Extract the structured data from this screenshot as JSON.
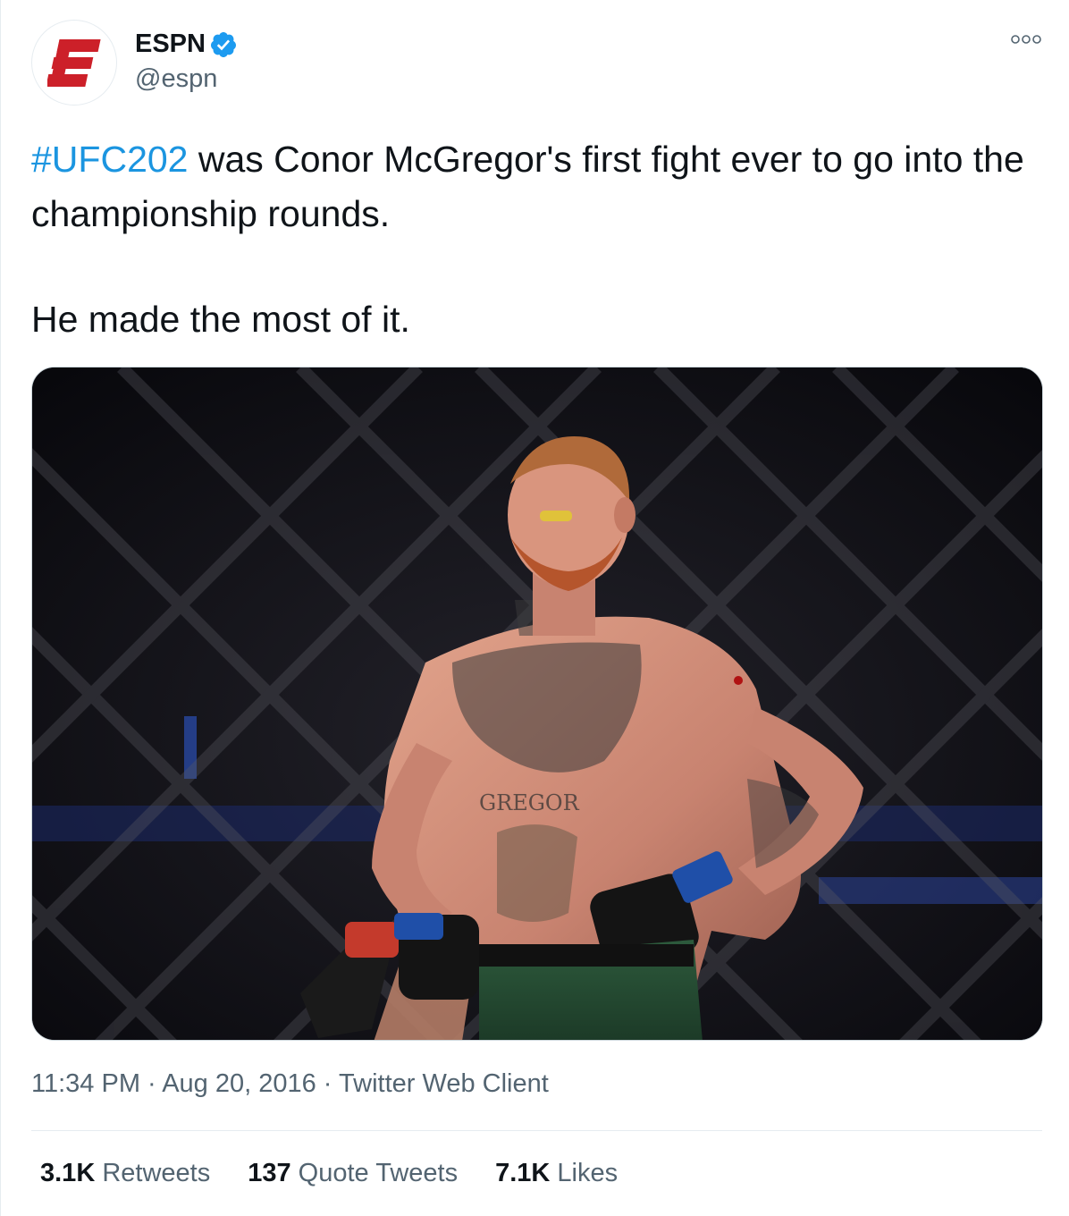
{
  "author": {
    "display_name": "ESPN",
    "handle": "@espn",
    "verified": true,
    "avatar_logo": "espn-e-logo",
    "brand_color": "#cc2029"
  },
  "tweet": {
    "hashtag": "#UFC202",
    "text_line1_rest": " was Conor McGregor's first fight ever to go into the championship rounds.",
    "text_para2": "He made the most of it.",
    "media_alt": "Conor McGregor in the octagon at UFC 202",
    "time": "11:34 PM",
    "separator": "·",
    "date": "Aug 20, 2016",
    "source": "Twitter Web Client"
  },
  "stats": {
    "retweets_count": "3.1K",
    "retweets_label": "Retweets",
    "quotes_count": "137",
    "quotes_label": "Quote Tweets",
    "likes_count": "7.1K",
    "likes_label": "Likes"
  },
  "colors": {
    "hashtag": "#1b95e0",
    "verified": "#1d9bf0",
    "secondary_text": "#536471"
  },
  "icons": {
    "verified": "verified-badge-icon",
    "more": "more-options-icon"
  }
}
